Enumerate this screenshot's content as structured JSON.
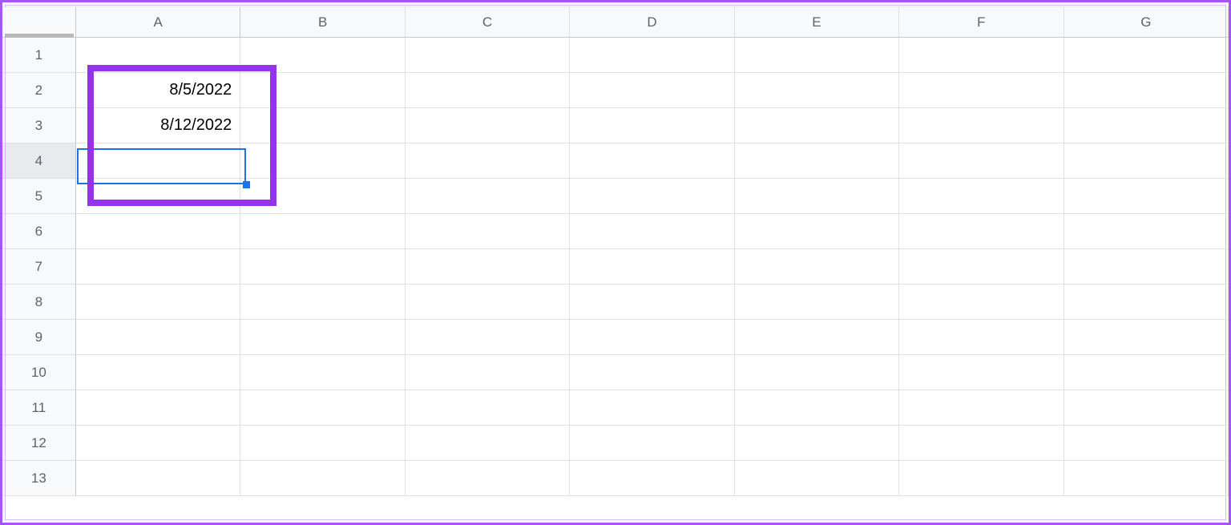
{
  "columns": [
    "A",
    "B",
    "C",
    "D",
    "E",
    "F",
    "G"
  ],
  "rows": [
    "1",
    "2",
    "3",
    "4",
    "5",
    "6",
    "7",
    "8",
    "9",
    "10",
    "11",
    "12",
    "13"
  ],
  "cells": {
    "A2": "8/5/2022",
    "A3": "8/12/2022"
  },
  "selection": {
    "active_cell": "A4",
    "active_row": "4"
  },
  "colors": {
    "selection_border": "#1a73e8",
    "annotation_border": "#9333ea"
  }
}
